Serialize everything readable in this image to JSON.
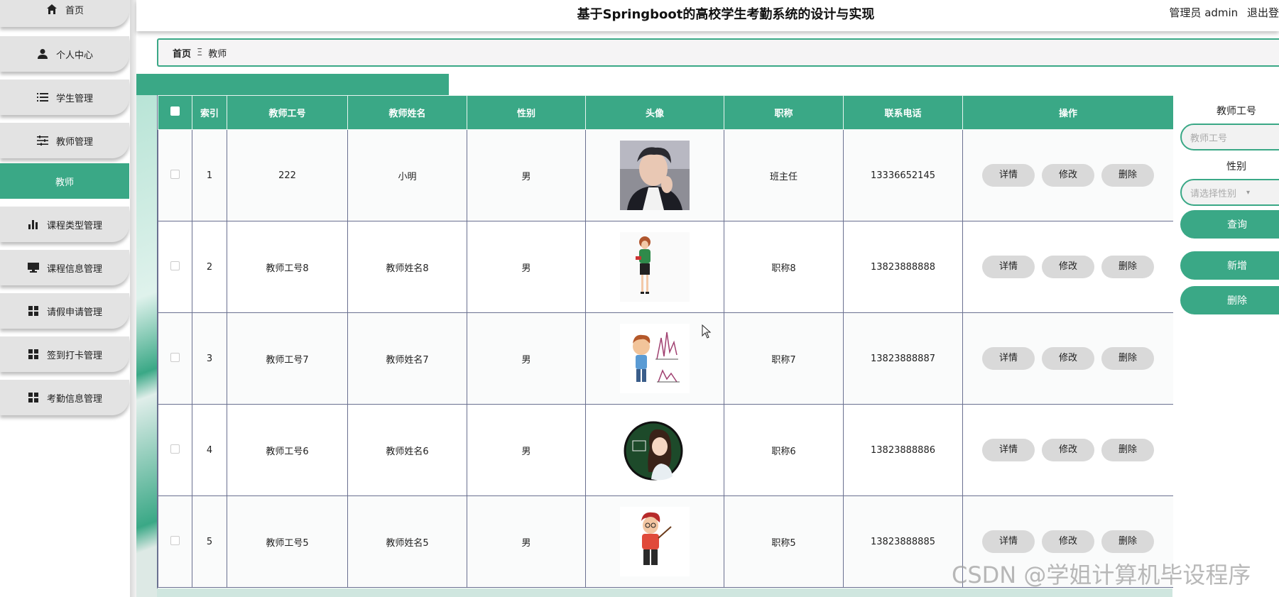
{
  "app": {
    "title": "基于Springboot的高校学生考勤系统的设计与实现",
    "user_label": "管理员 admin",
    "logout": "退出登"
  },
  "sidebar": {
    "items": [
      {
        "label": "首页",
        "icon": "home-icon"
      },
      {
        "label": "个人中心",
        "icon": "user-icon"
      },
      {
        "label": "学生管理",
        "icon": "list-icon"
      },
      {
        "label": "教师管理",
        "icon": "sliders-icon"
      },
      {
        "label": "课程类型管理",
        "icon": "bar-chart-icon"
      },
      {
        "label": "课程信息管理",
        "icon": "monitor-icon"
      },
      {
        "label": "请假申请管理",
        "icon": "grid-icon"
      },
      {
        "label": "签到打卡管理",
        "icon": "grid-icon"
      },
      {
        "label": "考勤信息管理",
        "icon": "grid-icon"
      }
    ],
    "active_sub": "教师"
  },
  "breadcrumb": {
    "home": "首页",
    "sep": "Ξ",
    "current": "教师"
  },
  "table": {
    "headers": [
      "索引",
      "教师工号",
      "教师姓名",
      "性别",
      "头像",
      "职称",
      "联系电话",
      "操作"
    ],
    "rows": [
      {
        "index": "1",
        "id": "222",
        "name": "小明",
        "gender": "男",
        "title": "班主任",
        "phone": "13336652145",
        "avatar": "photo-young-man"
      },
      {
        "index": "2",
        "id": "教师工号8",
        "name": "教师姓名8",
        "gender": "男",
        "title": "职称8",
        "phone": "13823888888",
        "avatar": "cartoon-female-teacher"
      },
      {
        "index": "3",
        "id": "教师工号7",
        "name": "教师姓名7",
        "gender": "男",
        "title": "职称7",
        "phone": "13823888887",
        "avatar": "cartoon-teacher-chart"
      },
      {
        "index": "4",
        "id": "教师工号6",
        "name": "教师姓名6",
        "gender": "男",
        "title": "职称6",
        "phone": "13823888886",
        "avatar": "cartoon-teacher-chalkboard"
      },
      {
        "index": "5",
        "id": "教师工号5",
        "name": "教师姓名5",
        "gender": "男",
        "title": "职称5",
        "phone": "13823888885",
        "avatar": "cartoon-teacher-pointer"
      }
    ],
    "actions": {
      "detail": "详情",
      "edit": "修改",
      "delete": "删除"
    }
  },
  "search": {
    "id_label": "教师工号",
    "id_placeholder": "教师工号",
    "gender_label": "性别",
    "gender_placeholder": "请选择性别",
    "query": "查询",
    "add": "新增",
    "delete": "删除"
  },
  "watermark": "CSDN @学姐计算机毕设程序",
  "colors": {
    "accent": "#3aa886",
    "nav_bg": "#e3e3e3"
  }
}
